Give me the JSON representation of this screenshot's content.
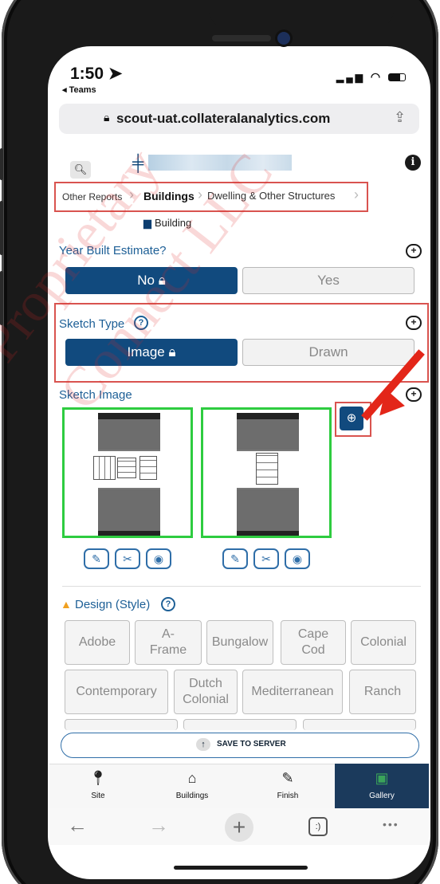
{
  "status": {
    "time": "1:50",
    "back": "◂ Teams",
    "icons": "▎▎▎ ◠ ▭"
  },
  "browser": {
    "url": "scout-uat.collateralanalytics.com"
  },
  "header": {
    "search_icon": "search-icon",
    "info_icon": "info-icon"
  },
  "breadcrumbs": [
    "Other Reports",
    "Buildings",
    "Dwelling & Other Structures"
  ],
  "building_label": "Building",
  "year_built": {
    "label": "Year Built Estimate?",
    "options": [
      "No",
      "Yes"
    ],
    "selected": "No"
  },
  "sketch_type": {
    "label": "Sketch Type",
    "options": [
      "Image",
      "Drawn"
    ],
    "selected": "Image"
  },
  "sketch_image": {
    "label": "Sketch Image",
    "thumb_count": 2
  },
  "design": {
    "label": "Design (Style)",
    "options_row1": [
      "Adobe",
      "A-\nFrame",
      "Bungalow",
      "Cape\nCod",
      "Colonial"
    ],
    "options_row2": [
      "Contemporary",
      "Dutch\nColonial",
      "Mediterranean",
      "Ranch"
    ]
  },
  "save_button": "SAVE TO SERVER",
  "tabs": [
    {
      "label": "Site",
      "icon": "map-pin-icon"
    },
    {
      "label": "Buildings",
      "icon": "house-icon"
    },
    {
      "label": "Finish",
      "icon": "finish-icon"
    },
    {
      "label": "Gallery",
      "icon": "gallery-icon",
      "active": true
    }
  ],
  "browser_controls": [
    "←",
    "→",
    "+",
    ":)",
    "•••"
  ],
  "watermark": [
    "Proprietary",
    "Connect LLC"
  ],
  "colors": {
    "primary": "#114a7e",
    "annotation": "#d9534f",
    "arrow": "#e32619",
    "thumb_border": "#2ecc40"
  }
}
